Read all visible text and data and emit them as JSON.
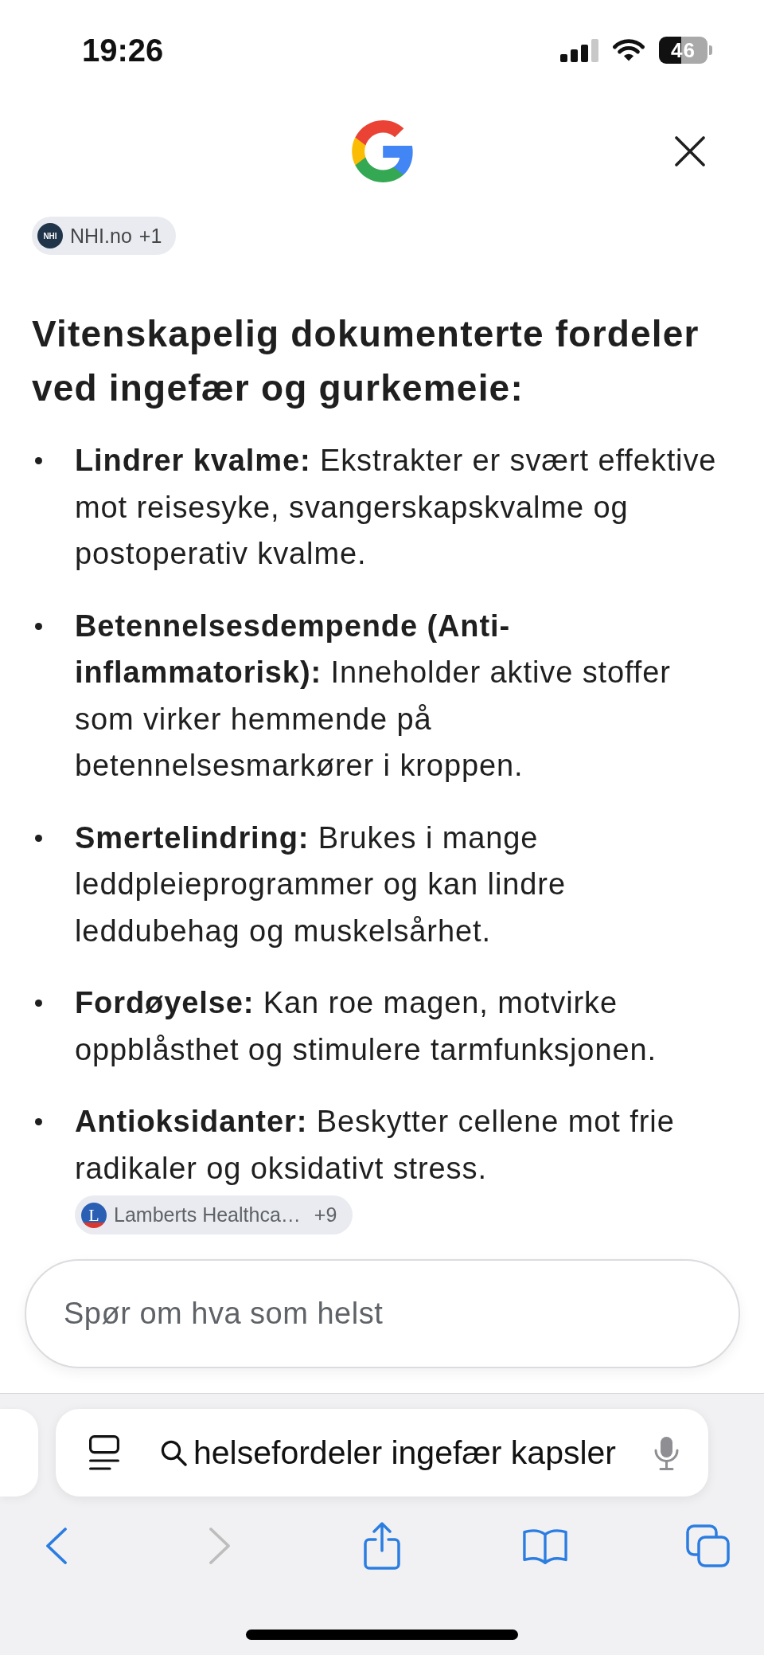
{
  "status_bar": {
    "time": "19:26",
    "battery": "46"
  },
  "answer": {
    "source_chip": {
      "logo_text": "NHI",
      "name": "NHI.no",
      "count": "+1"
    },
    "heading": "Vitenskapelig dokumenterte fordeler ved ingefær og gurkemeie:",
    "items": [
      "**Lindrer kvalme:** Ekstrakter er svært effektive mot reisesyke, svangerskapskvalme og postoperativ kvalme.",
      "**Betennelsesdempende (Anti-inflammatorisk):** Inneholder aktive stoffer som virker hemmende på betennelsesmarkører i kroppen.",
      "**Smertelindring:** Brukes i mange leddpleieprogrammer og kan lindre leddubehag og muskelsårhet.",
      "**Fordøyelse:** Kan roe magen, motvirke oppblåsthet og stimulere tarmfunksjonen.",
      "**Antioksidanter:** Beskytter cellene mot frie radikaler og oksidativt stress."
    ],
    "footer_source_chip": {
      "logo_text": "L",
      "name": "Lamberts Healthca…",
      "count": "+9"
    }
  },
  "ask_field": {
    "placeholder": "Spør om hva som helst"
  },
  "address_bar": {
    "query": "helsefordeler ingefær kapsler"
  },
  "toolbar": [
    {
      "kind": "back",
      "disabled": false
    },
    {
      "kind": "forward",
      "disabled": true
    },
    {
      "kind": "share",
      "disabled": false
    },
    {
      "kind": "bookmarks",
      "disabled": false
    },
    {
      "kind": "tabs",
      "disabled": false
    }
  ]
}
